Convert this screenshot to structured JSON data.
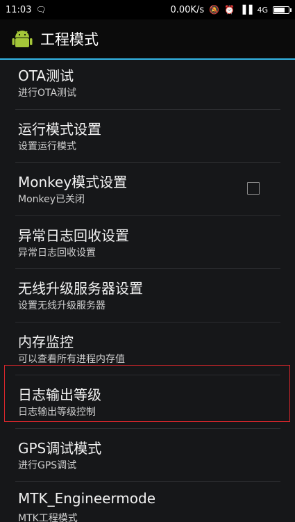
{
  "status_bar": {
    "time": "11:03",
    "notif_icons": "♾ ♾",
    "net_speed": "0.00K/s",
    "network": "4G",
    "battery_level": 0.8
  },
  "action_bar": {
    "title": "工程模式",
    "icon": "android-icon",
    "accent_color": "#33b5e5"
  },
  "list": {
    "items": [
      {
        "title": "OTA测试",
        "subtitle": "进行OTA测试"
      },
      {
        "title": "运行模式设置",
        "subtitle": "设置运行模式"
      },
      {
        "title": "Monkey模式设置",
        "subtitle": "Monkey已关闭",
        "checkbox": false
      },
      {
        "title": "异常日志回收设置",
        "subtitle": "异常日志回收设置"
      },
      {
        "title": "无线升级服务器设置",
        "subtitle": "设置无线升级服务器"
      },
      {
        "title": "内存监控",
        "subtitle": "可以查看所有进程内存值"
      },
      {
        "title": "日志输出等级",
        "subtitle": "日志输出等级控制"
      },
      {
        "title": "GPS调试模式",
        "subtitle": "进行GPS调试"
      },
      {
        "title": "MTK_Engineermode",
        "subtitle": "MTK工程模式"
      }
    ],
    "highlight_color": "#d9262c"
  }
}
